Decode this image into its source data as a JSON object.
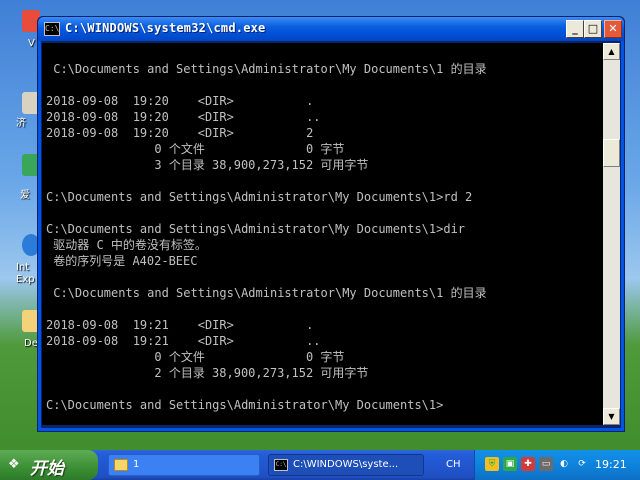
{
  "desktop": {
    "icons": [
      {
        "label": "V",
        "color": "#e84c3d"
      },
      {
        "label": "济",
        "color": "#d7d2c2"
      },
      {
        "label": "爱",
        "color": "#3aa65a"
      },
      {
        "label": "Int\nExp",
        "color": "#2b7bd9"
      },
      {
        "label": "De",
        "color": "#f4d27a"
      }
    ]
  },
  "window": {
    "title": "C:\\WINDOWS\\system32\\cmd.exe",
    "icon_label": "C:\\",
    "buttons": {
      "minimize": "_",
      "maximize": "□",
      "close": "✕"
    }
  },
  "console": {
    "text_color": "#c0c0c0",
    "background": "#000000",
    "lines": [
      "",
      " C:\\Documents and Settings\\Administrator\\My Documents\\1 的目录",
      "",
      "2018-09-08  19:20    <DIR>          .",
      "2018-09-08  19:20    <DIR>          ..",
      "2018-09-08  19:20    <DIR>          2",
      "               0 个文件              0 字节",
      "               3 个目录 38,900,273,152 可用字节",
      "",
      "C:\\Documents and Settings\\Administrator\\My Documents\\1>rd 2",
      "",
      "C:\\Documents and Settings\\Administrator\\My Documents\\1>dir",
      " 驱动器 C 中的卷没有标签。",
      " 卷的序列号是 A402-BEEC",
      "",
      " C:\\Documents and Settings\\Administrator\\My Documents\\1 的目录",
      "",
      "2018-09-08  19:21    <DIR>          .",
      "2018-09-08  19:21    <DIR>          ..",
      "               0 个文件              0 字节",
      "               2 个目录 38,900,273,152 可用字节",
      "",
      "C:\\Documents and Settings\\Administrator\\My Documents\\1>"
    ]
  },
  "scrollbar": {
    "up": "▲",
    "down": "▼"
  },
  "taskbar": {
    "start_label": "开始",
    "start_logo": "❖",
    "tasks": [
      {
        "label": "1",
        "icon": "folder-icon"
      },
      {
        "label": "C:\\WINDOWS\\syste...",
        "icon": "cmd-icon"
      }
    ],
    "language": "CH",
    "tray_icons": [
      "shield-icon",
      "network-icon",
      "antivirus-icon",
      "vm-icon",
      "speaker-icon",
      "update-icon"
    ],
    "clock": "19:21"
  }
}
